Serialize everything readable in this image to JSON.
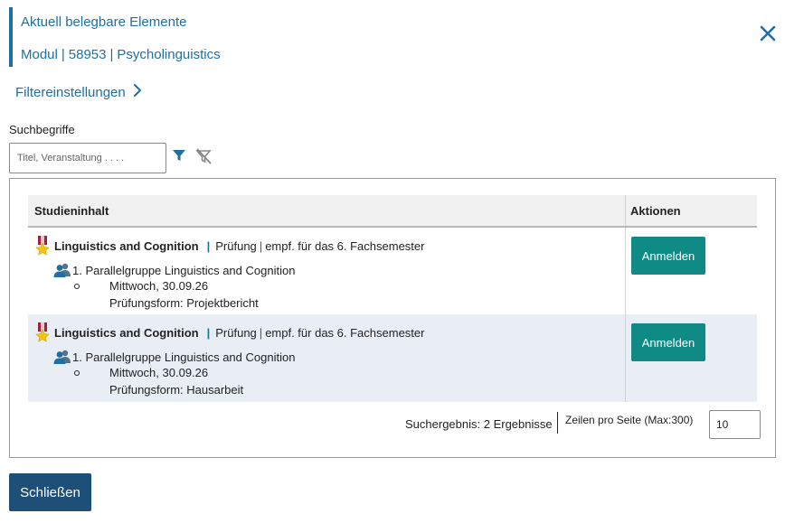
{
  "header": {
    "title": "Aktuell belegbare Elemente",
    "module_label": "Modul",
    "module_number": "58953",
    "module_name": "Psycholinguistics"
  },
  "filter_settings": {
    "label": "Filtereinstellungen"
  },
  "search": {
    "label": "Suchbegriffe",
    "placeholder": "Titel, Veranstaltung . . . .",
    "value": ""
  },
  "table": {
    "headers": {
      "content": "Studieninhalt",
      "actions": "Aktionen"
    },
    "rows": [
      {
        "course": "Linguistics and Cognition",
        "type": "Prüfung",
        "recommendation": "empf. für das 6. Fachsemester",
        "group": "1. Parallelgruppe Linguistics and Cognition",
        "date": "Mittwoch, 30.09.26",
        "exam_form": "Prüfungsform: Projektbericht",
        "action_label": "Anmelden"
      },
      {
        "course": "Linguistics and Cognition",
        "type": "Prüfung",
        "recommendation": "empf. für das 6. Fachsemester",
        "group": "1. Parallelgruppe Linguistics and Cognition",
        "date": "Mittwoch, 30.09.26",
        "exam_form": "Prüfungsform: Hausarbeit",
        "action_label": "Anmelden"
      }
    ]
  },
  "footer": {
    "results_text": "Suchergebnis: 2 Ergebnisse",
    "rows_per_page_label": "Zeilen pro Seite (Max:300)",
    "rows_per_page_value": "10"
  },
  "close_button": {
    "label": "Schließen"
  },
  "colors": {
    "accent": "#1f6fa3",
    "register_button": "#0f8a84",
    "close_button": "#1e4f79",
    "alt_row": "#e9eef5"
  },
  "icons": [
    "close-icon",
    "chevron-right-icon",
    "filter-icon",
    "filter-off-icon",
    "award-icon",
    "group-icon"
  ]
}
